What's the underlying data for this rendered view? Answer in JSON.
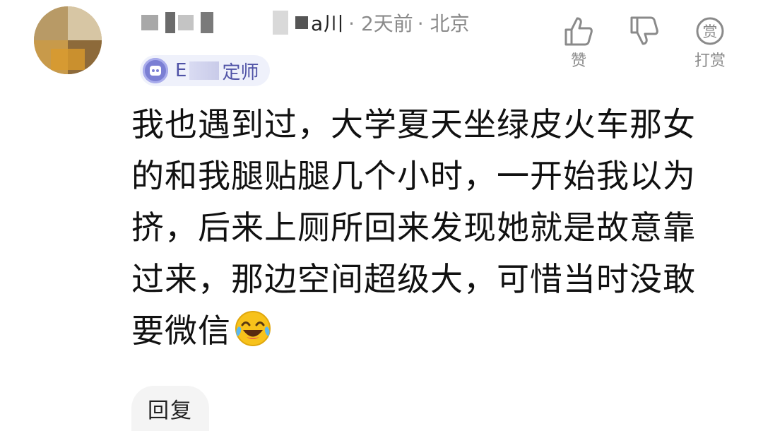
{
  "comment": {
    "username_suffix": "a川",
    "time": "· 2天前",
    "location": "· 北京",
    "badge_prefix": "E",
    "badge_suffix": "定师",
    "lines": [
      "我也遇到过，大学夏天坐绿皮火车那女",
      "的和我腿贴腿几个小时，一开始我以为",
      "挤，后来上厕所回来发现她就是故意靠",
      "过来，那边空间超级大，可惜当时没敢",
      "要微信"
    ],
    "emoji": "laughing-crying-emoji"
  },
  "actions": {
    "like_label": "赞",
    "dislike_label": "",
    "tip_label": "打赏",
    "tip_icon_text": "赏"
  },
  "reply_label": "回复",
  "colors": {
    "text": "#111111",
    "meta": "#8a8a8a",
    "badge_bg": "#eff1fb",
    "badge_text": "#4f52a6",
    "reply_bg": "#f4f4f4"
  }
}
